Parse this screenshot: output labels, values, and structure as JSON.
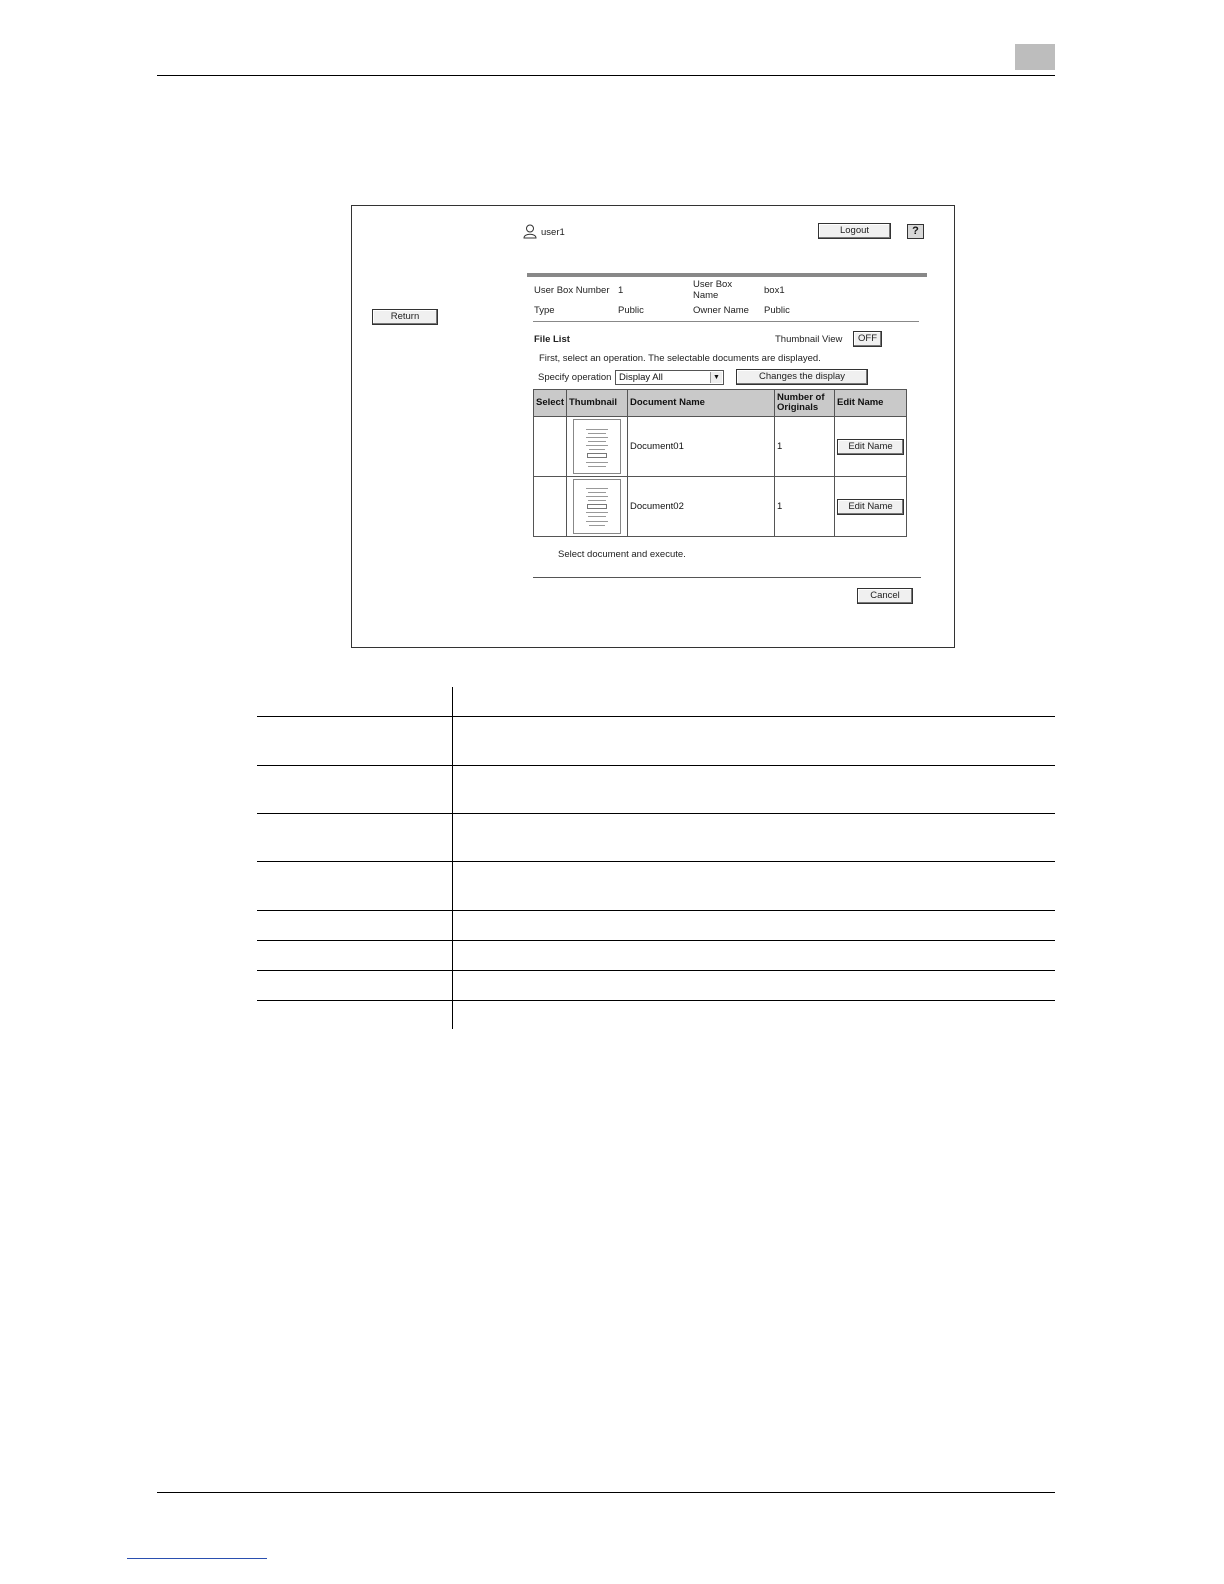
{
  "header": {
    "page_number_tab": ""
  },
  "screen": {
    "user_name": "user1",
    "logout_label": "Logout",
    "help_label": "?",
    "return_label": "Return",
    "box_info": {
      "box_number_label": "User Box Number",
      "box_number_value": "1",
      "box_name_label_line1": "User Box",
      "box_name_label_line2": "Name",
      "box_name_value": "box1",
      "type_label": "Type",
      "type_value": "Public",
      "owner_label": "Owner Name",
      "owner_value": "Public"
    },
    "file_list_title": "File List",
    "thumbnail_view_label": "Thumbnail View",
    "thumbnail_view_value": "OFF",
    "instruction": "First, select an operation. The selectable documents are displayed.",
    "specify_operation_label": "Specify operation",
    "specify_operation_value": "Display All",
    "changes_display_label": "Changes the display",
    "table": {
      "headers": {
        "select": "Select",
        "thumbnail": "Thumbnail",
        "document_name": "Document Name",
        "originals_line1": "Number of",
        "originals_line2": "Originals",
        "edit_name": "Edit Name"
      },
      "rows": [
        {
          "document_name": "Document01",
          "originals": "1",
          "edit_label": "Edit Name"
        },
        {
          "document_name": "Document02",
          "originals": "1",
          "edit_label": "Edit Name"
        }
      ]
    },
    "footer_note": "Select document and execute.",
    "cancel_label": "Cancel"
  }
}
